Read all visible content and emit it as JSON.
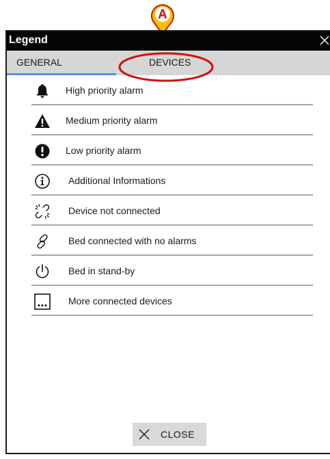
{
  "window": {
    "title": "Legend"
  },
  "tabs": [
    {
      "label": "GENERAL",
      "active": true
    },
    {
      "label": "DEVICES",
      "active": false
    }
  ],
  "legend_items": [
    {
      "icon": "bell-icon",
      "label": "High priority alarm"
    },
    {
      "icon": "warning-triangle-icon",
      "label": "Medium priority alarm"
    },
    {
      "icon": "exclamation-circle-icon",
      "label": "Low priority alarm"
    },
    {
      "icon": "info-circle-icon",
      "label": "Additional Informations"
    },
    {
      "icon": "broken-link-icon",
      "label": "Device not connected"
    },
    {
      "icon": "link-icon",
      "label": "Bed connected with no alarms"
    },
    {
      "icon": "power-icon",
      "label": "Bed in stand-by"
    },
    {
      "icon": "ellipsis-box-icon",
      "label": "More connected devices"
    }
  ],
  "close_button": {
    "label": "CLOSE"
  },
  "annotation": {
    "marker_label": "A"
  },
  "colors": {
    "titlebar": "#050505",
    "tabbar": "#d6d6d6",
    "tab_underline": "#5b8dd6",
    "annotation": "#d21010",
    "marker_fill": "#f2c200"
  }
}
